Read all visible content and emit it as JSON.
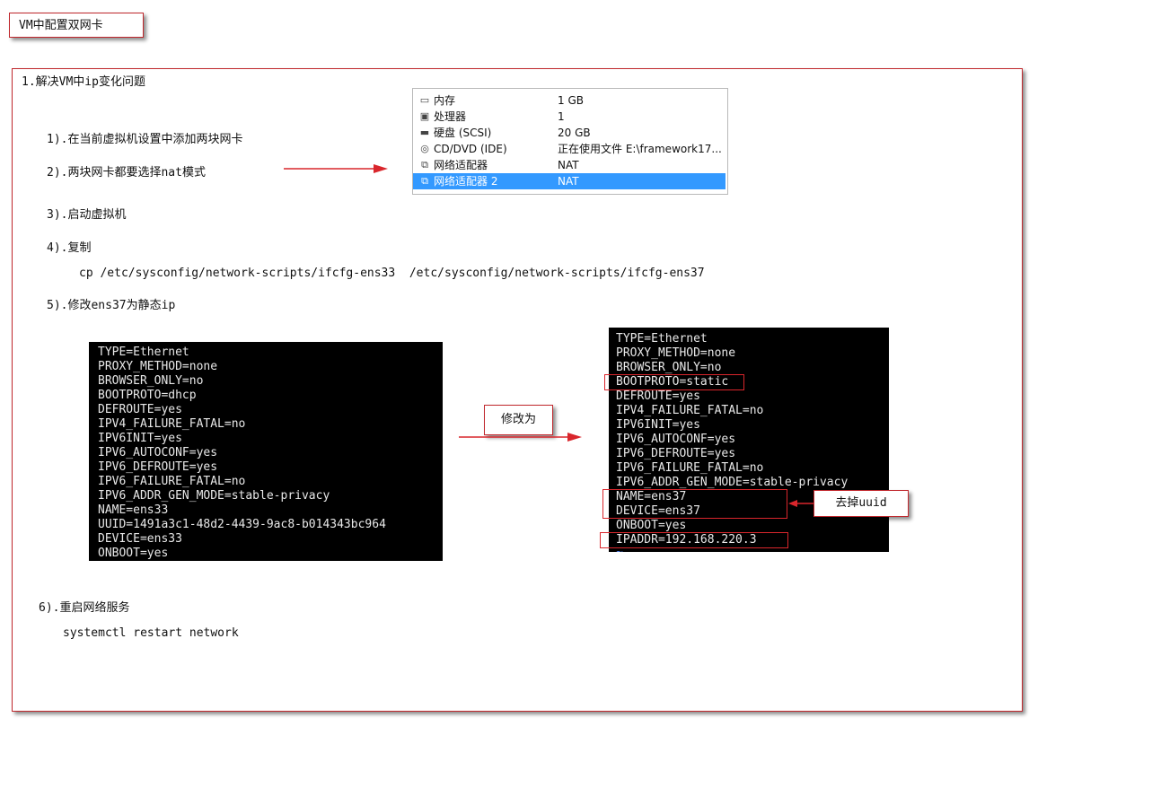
{
  "title": "VM中配置双网卡",
  "heading": "1.解决VM中ip变化问题",
  "steps": {
    "s1": "1).在当前虚拟机设置中添加两块网卡",
    "s2": "2).两块网卡都要选择nat模式",
    "s3": "3).启动虚拟机",
    "s4": "4).复制",
    "cp_cmd": "cp /etc/sysconfig/network-scripts/ifcfg-ens33  /etc/sysconfig/network-scripts/ifcfg-ens37",
    "s5": "5).修改ens37为静态ip",
    "s6": "6).重启网络服务",
    "restart_cmd": "systemctl restart network"
  },
  "vm_settings": [
    {
      "icon": "memory-icon",
      "glyph": "▭",
      "name": "内存",
      "value": "1 GB"
    },
    {
      "icon": "processor-icon",
      "glyph": "▣",
      "name": "处理器",
      "value": "1"
    },
    {
      "icon": "hard-disk-icon",
      "glyph": "▬",
      "name": "硬盘 (SCSI)",
      "value": "20 GB"
    },
    {
      "icon": "cd-dvd-icon",
      "glyph": "◎",
      "name": "CD/DVD (IDE)",
      "value": "正在使用文件 E:\\framework17..."
    },
    {
      "icon": "network-adapter-icon",
      "glyph": "⧉",
      "name": "网络适配器",
      "value": "NAT"
    },
    {
      "icon": "network-adapter-icon",
      "glyph": "⧉",
      "name": "网络适配器 2",
      "value": "NAT"
    }
  ],
  "term_before": [
    "TYPE=Ethernet",
    "PROXY_METHOD=none",
    "BROWSER_ONLY=no",
    "BOOTPROTO=dhcp",
    "DEFROUTE=yes",
    "IPV4_FAILURE_FATAL=no",
    "IPV6INIT=yes",
    "IPV6_AUTOCONF=yes",
    "IPV6_DEFROUTE=yes",
    "IPV6_FAILURE_FATAL=no",
    "IPV6_ADDR_GEN_MODE=stable-privacy",
    "NAME=ens33",
    "UUID=1491a3c1-48d2-4439-9ac8-b014343bc964",
    "DEVICE=ens33",
    "ONBOOT=yes"
  ],
  "term_after": [
    "TYPE=Ethernet",
    "PROXY_METHOD=none",
    "BROWSER_ONLY=no",
    "BOOTPROTO=static",
    "DEFROUTE=yes",
    "IPV4_FAILURE_FATAL=no",
    "IPV6INIT=yes",
    "IPV6_AUTOCONF=yes",
    "IPV6_DEFROUTE=yes",
    "IPV6_FAILURE_FATAL=no",
    "IPV6_ADDR_GEN_MODE=stable-privacy",
    "NAME=ens37",
    "DEVICE=ens37",
    "ONBOOT=yes",
    "IPADDR=192.168.220.3",
    "~"
  ],
  "callouts": {
    "modify": "修改为",
    "remove_uuid": "去掉uuid"
  },
  "colors": {
    "frame_border": "#c0282d",
    "arrow": "#d9262c",
    "selection": "#3399ff",
    "terminal_bg": "#000000"
  }
}
